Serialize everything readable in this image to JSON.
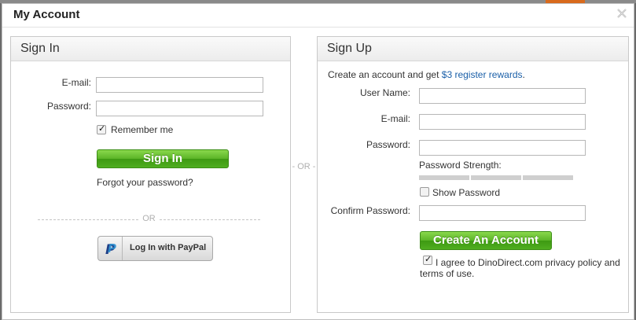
{
  "dialog": {
    "title": "My Account"
  },
  "signin": {
    "heading": "Sign In",
    "email_label": "E-mail:",
    "email_value": "",
    "password_label": "Password:",
    "password_value": "",
    "remember_label": "Remember me",
    "remember_checked": true,
    "submit_label": "Sign In",
    "forgot_label": "Forgot your password?",
    "or_label": "OR",
    "paypal_label": "Log In with PayPal"
  },
  "divider": {
    "or_label": "- OR -"
  },
  "signup": {
    "heading": "Sign Up",
    "intro_text": "Create an account and get ",
    "intro_link": "$3 register rewards",
    "intro_end": ".",
    "username_label": "User Name:",
    "username_value": "",
    "email_label": "E-mail:",
    "email_value": "",
    "password_label": "Password:",
    "password_value": "",
    "strength_label": "Password Strength:",
    "show_password_label": "Show Password",
    "show_password_checked": false,
    "confirm_label": "Confirm Password:",
    "confirm_value": "",
    "submit_label": "Create An Account",
    "agree_line1": "I agree to DinoDirect.com privacy policy and",
    "agree_line2": "terms of use.",
    "agree_checked": true
  },
  "colors": {
    "accent_green": "#4fae20",
    "link_blue": "#1a5fa8",
    "paypal_blue": "#1f3f87"
  },
  "icons": {
    "close": "close-icon",
    "paypal": "paypal-icon"
  }
}
